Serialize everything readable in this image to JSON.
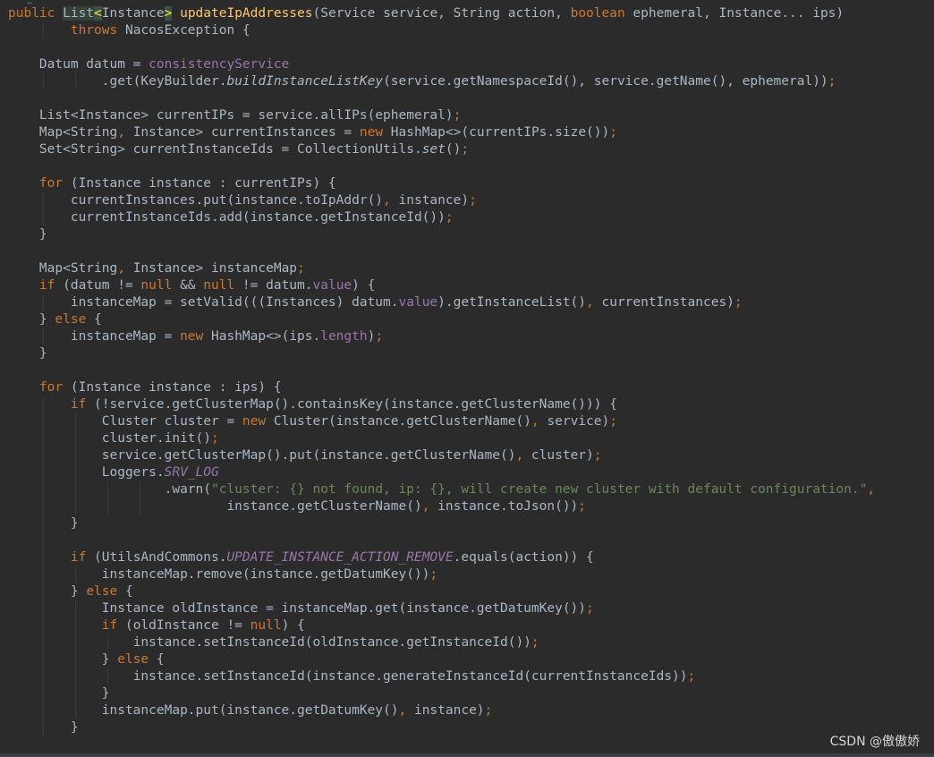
{
  "editor": {
    "watermark": "CSDN @傲傲娇",
    "lines": [
      {
        "indent": 0,
        "tokens": [
          {
            "t": "public",
            "c": "kw"
          },
          {
            "t": " "
          },
          {
            "t": "List",
            "c": "hl"
          },
          {
            "t": "<",
            "c": "hl-bracket"
          },
          {
            "t": "Instance"
          },
          {
            "t": ">",
            "c": "hl-bracket"
          },
          {
            "t": " "
          },
          {
            "t": "updateIpAddresses",
            "c": "method-decl"
          },
          {
            "t": "(Service service, String action, "
          },
          {
            "t": "boolean",
            "c": "kw"
          },
          {
            "t": " ephemeral, Instance... ips)"
          }
        ]
      },
      {
        "indent": 8,
        "tokens": [
          {
            "t": "throws",
            "c": "kw"
          },
          {
            "t": " NacosException {"
          }
        ]
      },
      {
        "indent": 0,
        "tokens": []
      },
      {
        "indent": 4,
        "tokens": [
          {
            "t": "Datum datum = "
          },
          {
            "t": "consistencyService",
            "c": "field"
          }
        ]
      },
      {
        "indent": 12,
        "tokens": [
          {
            "t": ".get(KeyBuilder."
          },
          {
            "t": "buildInstanceListKey",
            "c": "italic"
          },
          {
            "t": "(service.getNamespaceId(), service.getName(), ephemeral))"
          },
          {
            "t": ";",
            "c": "kw"
          }
        ]
      },
      {
        "indent": 0,
        "tokens": []
      },
      {
        "indent": 4,
        "tokens": [
          {
            "t": "List<Instance> currentIPs = service.allIPs(ephemeral)"
          },
          {
            "t": ";",
            "c": "kw"
          }
        ]
      },
      {
        "indent": 4,
        "tokens": [
          {
            "t": "Map<String"
          },
          {
            "t": ",",
            "c": "kw"
          },
          {
            "t": " Instance> currentInstances = "
          },
          {
            "t": "new",
            "c": "kw"
          },
          {
            "t": " HashMap<>(currentIPs.size())"
          },
          {
            "t": ";",
            "c": "kw"
          }
        ]
      },
      {
        "indent": 4,
        "tokens": [
          {
            "t": "Set<String> currentInstanceIds = CollectionUtils."
          },
          {
            "t": "set",
            "c": "italic"
          },
          {
            "t": "()"
          },
          {
            "t": ";",
            "c": "kw"
          }
        ]
      },
      {
        "indent": 0,
        "tokens": []
      },
      {
        "indent": 4,
        "tokens": [
          {
            "t": "for",
            "c": "kw"
          },
          {
            "t": " (Instance instance : currentIPs) {"
          }
        ]
      },
      {
        "indent": 8,
        "tokens": [
          {
            "t": "currentInstances.put(instance.toIpAddr()"
          },
          {
            "t": ",",
            "c": "kw"
          },
          {
            "t": " instance)"
          },
          {
            "t": ";",
            "c": "kw"
          }
        ]
      },
      {
        "indent": 8,
        "tokens": [
          {
            "t": "currentInstanceIds.add(instance.getInstanceId())"
          },
          {
            "t": ";",
            "c": "kw"
          }
        ]
      },
      {
        "indent": 4,
        "tokens": [
          {
            "t": "}"
          }
        ]
      },
      {
        "indent": 0,
        "tokens": []
      },
      {
        "indent": 4,
        "tokens": [
          {
            "t": "Map<String"
          },
          {
            "t": ",",
            "c": "kw"
          },
          {
            "t": " Instance> instanceMap"
          },
          {
            "t": ";",
            "c": "kw"
          }
        ]
      },
      {
        "indent": 4,
        "tokens": [
          {
            "t": "if",
            "c": "kw"
          },
          {
            "t": " (datum != "
          },
          {
            "t": "null",
            "c": "kw"
          },
          {
            "t": " && "
          },
          {
            "t": "null",
            "c": "kw"
          },
          {
            "t": " != datum."
          },
          {
            "t": "value",
            "c": "field"
          },
          {
            "t": ") {"
          }
        ]
      },
      {
        "indent": 8,
        "tokens": [
          {
            "t": "instanceMap = setValid(((Instances) datum."
          },
          {
            "t": "value",
            "c": "field"
          },
          {
            "t": ").getInstanceList()"
          },
          {
            "t": ",",
            "c": "kw"
          },
          {
            "t": " currentInstances)"
          },
          {
            "t": ";",
            "c": "kw"
          }
        ]
      },
      {
        "indent": 4,
        "tokens": [
          {
            "t": "} "
          },
          {
            "t": "else",
            "c": "kw"
          },
          {
            "t": " {"
          }
        ]
      },
      {
        "indent": 8,
        "tokens": [
          {
            "t": "instanceMap = "
          },
          {
            "t": "new",
            "c": "kw"
          },
          {
            "t": " HashMap<>(ips."
          },
          {
            "t": "length",
            "c": "field"
          },
          {
            "t": ")"
          },
          {
            "t": ";",
            "c": "kw"
          }
        ]
      },
      {
        "indent": 4,
        "tokens": [
          {
            "t": "}"
          }
        ]
      },
      {
        "indent": 0,
        "tokens": []
      },
      {
        "indent": 4,
        "tokens": [
          {
            "t": "for",
            "c": "kw"
          },
          {
            "t": " (Instance instance : ips) {"
          }
        ]
      },
      {
        "indent": 8,
        "tokens": [
          {
            "t": "if",
            "c": "kw"
          },
          {
            "t": " (!service.getClusterMap().containsKey(instance.getClusterName())) {"
          }
        ]
      },
      {
        "indent": 12,
        "tokens": [
          {
            "t": "Cluster cluster = "
          },
          {
            "t": "new",
            "c": "kw"
          },
          {
            "t": " Cluster(instance.getClusterName()"
          },
          {
            "t": ",",
            "c": "kw"
          },
          {
            "t": " service)"
          },
          {
            "t": ";",
            "c": "kw"
          }
        ]
      },
      {
        "indent": 12,
        "tokens": [
          {
            "t": "cluster.init()"
          },
          {
            "t": ";",
            "c": "kw"
          }
        ]
      },
      {
        "indent": 12,
        "tokens": [
          {
            "t": "service.getClusterMap().put(instance.getClusterName()"
          },
          {
            "t": ",",
            "c": "kw"
          },
          {
            "t": " cluster)"
          },
          {
            "t": ";",
            "c": "kw"
          }
        ]
      },
      {
        "indent": 12,
        "tokens": [
          {
            "t": "Loggers."
          },
          {
            "t": "SRV_LOG",
            "c": "static"
          }
        ]
      },
      {
        "indent": 20,
        "tokens": [
          {
            "t": ".warn("
          },
          {
            "t": "\"cluster: {} not found, ip: {}, will create new cluster with default configuration.\"",
            "c": "string"
          },
          {
            "t": ",",
            "c": "kw"
          }
        ]
      },
      {
        "indent": 28,
        "tokens": [
          {
            "t": "instance.getClusterName()"
          },
          {
            "t": ",",
            "c": "kw"
          },
          {
            "t": " instance.toJson())"
          },
          {
            "t": ";",
            "c": "kw"
          }
        ]
      },
      {
        "indent": 8,
        "tokens": [
          {
            "t": "}"
          }
        ]
      },
      {
        "indent": 0,
        "tokens": []
      },
      {
        "indent": 8,
        "tokens": [
          {
            "t": "if",
            "c": "kw"
          },
          {
            "t": " (UtilsAndCommons."
          },
          {
            "t": "UPDATE_INSTANCE_ACTION_REMOVE",
            "c": "static"
          },
          {
            "t": ".equals(action)) {"
          }
        ]
      },
      {
        "indent": 12,
        "tokens": [
          {
            "t": "instanceMap.remove(instance.getDatumKey())"
          },
          {
            "t": ";",
            "c": "kw"
          }
        ]
      },
      {
        "indent": 8,
        "tokens": [
          {
            "t": "} "
          },
          {
            "t": "else",
            "c": "kw"
          },
          {
            "t": " {"
          }
        ]
      },
      {
        "indent": 12,
        "tokens": [
          {
            "t": "Instance oldInstance = instanceMap.get(instance.getDatumKey())"
          },
          {
            "t": ";",
            "c": "kw"
          }
        ]
      },
      {
        "indent": 12,
        "tokens": [
          {
            "t": "if",
            "c": "kw"
          },
          {
            "t": " (oldInstance != "
          },
          {
            "t": "null",
            "c": "kw"
          },
          {
            "t": ") {"
          }
        ]
      },
      {
        "indent": 16,
        "tokens": [
          {
            "t": "instance.setInstanceId(oldInstance.getInstanceId())"
          },
          {
            "t": ";",
            "c": "kw"
          }
        ]
      },
      {
        "indent": 12,
        "tokens": [
          {
            "t": "} "
          },
          {
            "t": "else",
            "c": "kw"
          },
          {
            "t": " {"
          }
        ]
      },
      {
        "indent": 16,
        "tokens": [
          {
            "t": "instance.setInstanceId(instance.generateInstanceId(currentInstanceIds))"
          },
          {
            "t": ";",
            "c": "kw"
          }
        ]
      },
      {
        "indent": 12,
        "tokens": [
          {
            "t": "}"
          }
        ]
      },
      {
        "indent": 12,
        "tokens": [
          {
            "t": "instanceMap.put(instance.getDatumKey()"
          },
          {
            "t": ",",
            "c": "kw"
          },
          {
            "t": " instance)"
          },
          {
            "t": ";",
            "c": "kw"
          }
        ]
      },
      {
        "indent": 8,
        "tokens": [
          {
            "t": "}"
          }
        ]
      }
    ]
  }
}
